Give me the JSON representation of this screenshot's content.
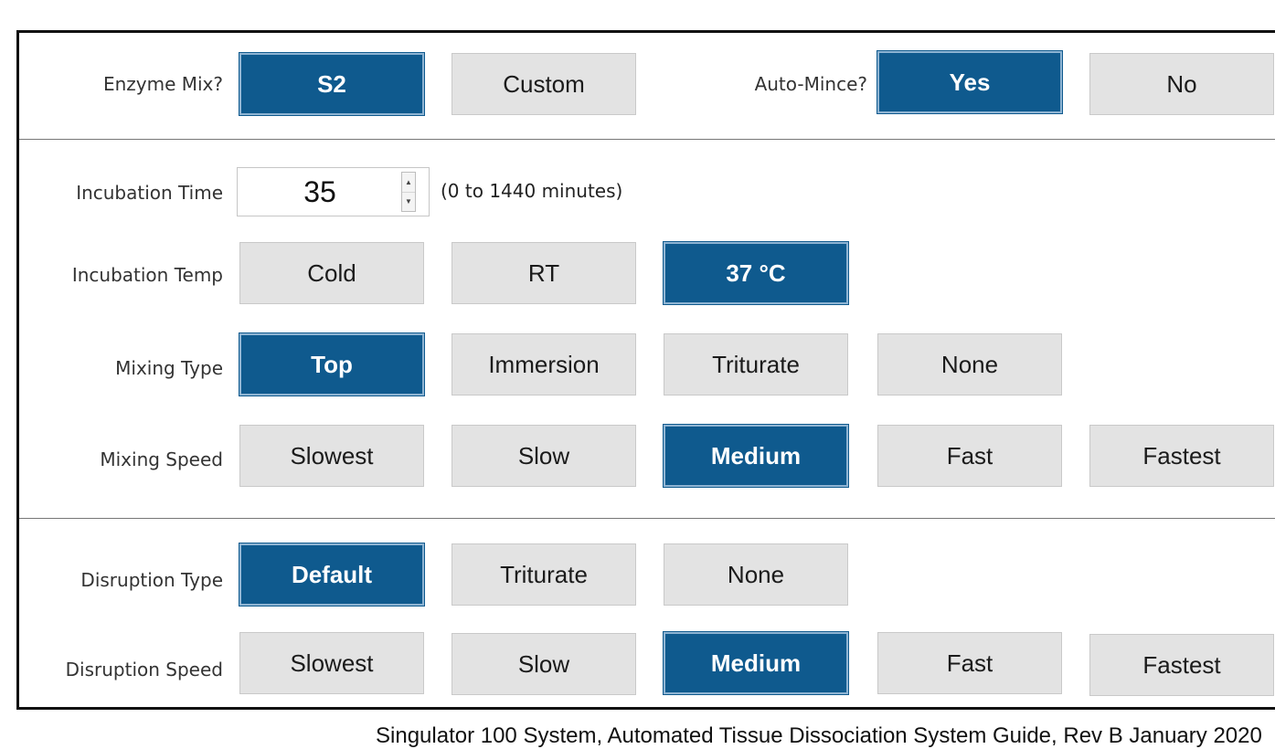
{
  "enzyme_mix": {
    "label": "Enzyme Mix?",
    "options": [
      "S2",
      "Custom"
    ],
    "selected": "S2"
  },
  "auto_mince": {
    "label": "Auto-Mince?",
    "options": [
      "Yes",
      "No"
    ],
    "selected": "Yes"
  },
  "incubation_time": {
    "label": "Incubation Time",
    "value": "35",
    "range": "(0 to 1440 minutes)"
  },
  "incubation_temp": {
    "label": "Incubation Temp",
    "options": [
      "Cold",
      "RT",
      "37 °C"
    ],
    "selected": "37 °C"
  },
  "mixing_type": {
    "label": "Mixing Type",
    "options": [
      "Top",
      "Immersion",
      "Triturate",
      "None"
    ],
    "selected": "Top"
  },
  "mixing_speed": {
    "label": "Mixing Speed",
    "options": [
      "Slowest",
      "Slow",
      "Medium",
      "Fast",
      "Fastest"
    ],
    "selected": "Medium"
  },
  "disruption_type": {
    "label": "Disruption Type",
    "options": [
      "Default",
      "Triturate",
      "None"
    ],
    "selected": "Default"
  },
  "disruption_speed": {
    "label": "Disruption Speed",
    "options": [
      "Slowest",
      "Slow",
      "Medium",
      "Fast",
      "Fastest"
    ],
    "selected": "Medium"
  },
  "footer": {
    "caption": "Singulator 100 System, Automated Tissue Dissociation System Guide, Rev B January 2020"
  },
  "colors": {
    "selected_bg": "#0f5a8e",
    "unselected_bg": "#e3e3e3"
  },
  "icons": {
    "spin_up": "chevron-up-icon",
    "spin_down": "chevron-down-icon"
  }
}
